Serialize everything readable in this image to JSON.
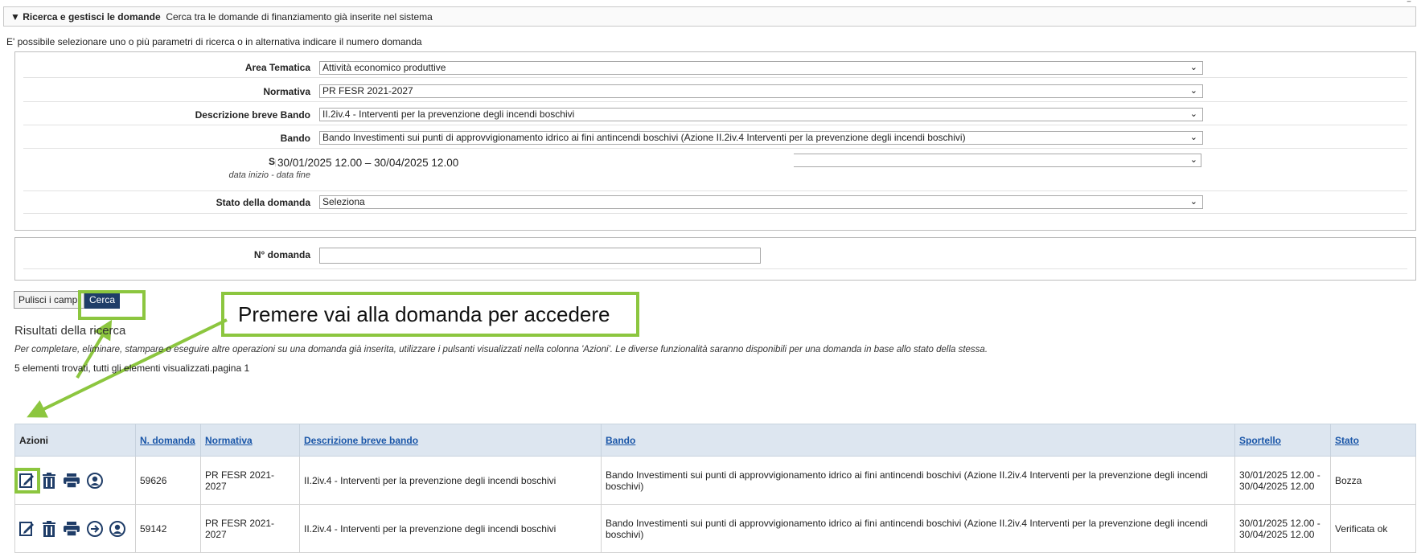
{
  "section": {
    "title": "Ricerca e gestisci le domande",
    "subtitle": "Cerca tra le domande di finanziamento già inserite nel sistema",
    "collapse_mark": "‾"
  },
  "intro": "E' possibile selezionare uno o più parametri di ricerca o in alternativa indicare il numero domanda",
  "filters": {
    "area_label": "Area Tematica",
    "area_value": "Attività economico produttive",
    "normativa_label": "Normativa",
    "normativa_value": "PR FESR 2021-2027",
    "descr_label": "Descrizione breve Bando",
    "descr_value": "II.2iv.4 - Interventi per la prevenzione degli incendi boschivi",
    "bando_label": "Bando",
    "bando_value": "Bando Investimenti sui punti di approvvigionamento idrico ai fini antincendi boschivi (Azione II.2iv.4 Interventi per la prevenzione degli incendi boschivi)",
    "sportello_label": "Sportello",
    "sportello_sub": "data inizio - data fine",
    "sportello_value": "30/01/2025 12.00 – 30/04/2025 12.00",
    "stato_label": "Stato della domanda",
    "stato_value": "Seleziona"
  },
  "num_domanda": {
    "label": "N° domanda",
    "value": ""
  },
  "buttons": {
    "clear": "Pulisci i campi",
    "search": "Cerca"
  },
  "callout": "Premere vai alla domanda per accedere",
  "results": {
    "heading": "Risultati della ricerca",
    "note": "Per completare, eliminare, stampare o eseguire altre operazioni su una domanda già inserita, utilizzare i pulsanti visualizzati nella colonna 'Azioni'. Le diverse funzionalità saranno disponibili per una domanda in base allo stato della stessa.",
    "count": "5 elementi trovati, tutti gli elementi visualizzati.pagina 1",
    "columns": {
      "azioni": "Azioni",
      "numero": "N. domanda",
      "normativa": "Normativa",
      "descrizione": "Descrizione breve bando",
      "bando": "Bando",
      "sportello": "Sportello",
      "stato": "Stato"
    },
    "rows": [
      {
        "numero": "59626",
        "normativa": "PR FESR 2021-2027",
        "descrizione": "II.2iv.4 - Interventi per la prevenzione degli incendi boschivi",
        "bando": "Bando Investimenti sui punti di approvvigionamento idrico ai fini antincendi boschivi (Azione II.2iv.4 Interventi per la prevenzione degli incendi boschivi)",
        "sportello": "30/01/2025 12.00 - 30/04/2025 12.00",
        "stato": "Bozza",
        "icons": [
          "edit-icon",
          "trash-icon",
          "print-icon",
          "user-icon"
        ]
      },
      {
        "numero": "59142",
        "normativa": "PR FESR 2021-2027",
        "descrizione": "II.2iv.4 - Interventi per la prevenzione degli incendi boschivi",
        "bando": "Bando Investimenti sui punti di approvvigionamento idrico ai fini antincendi boschivi (Azione II.2iv.4 Interventi per la prevenzione degli incendi boschivi)",
        "sportello": "30/01/2025 12.00 - 30/04/2025 12.00",
        "stato": "Verificata ok",
        "icons": [
          "edit-icon",
          "trash-icon",
          "print-icon",
          "arrow-right-icon",
          "user-icon"
        ]
      }
    ]
  },
  "colors": {
    "highlight": "#8cc63f",
    "primary_button": "#1f3d68",
    "header_bg": "#dde6f0",
    "link": "#1a56a8"
  }
}
